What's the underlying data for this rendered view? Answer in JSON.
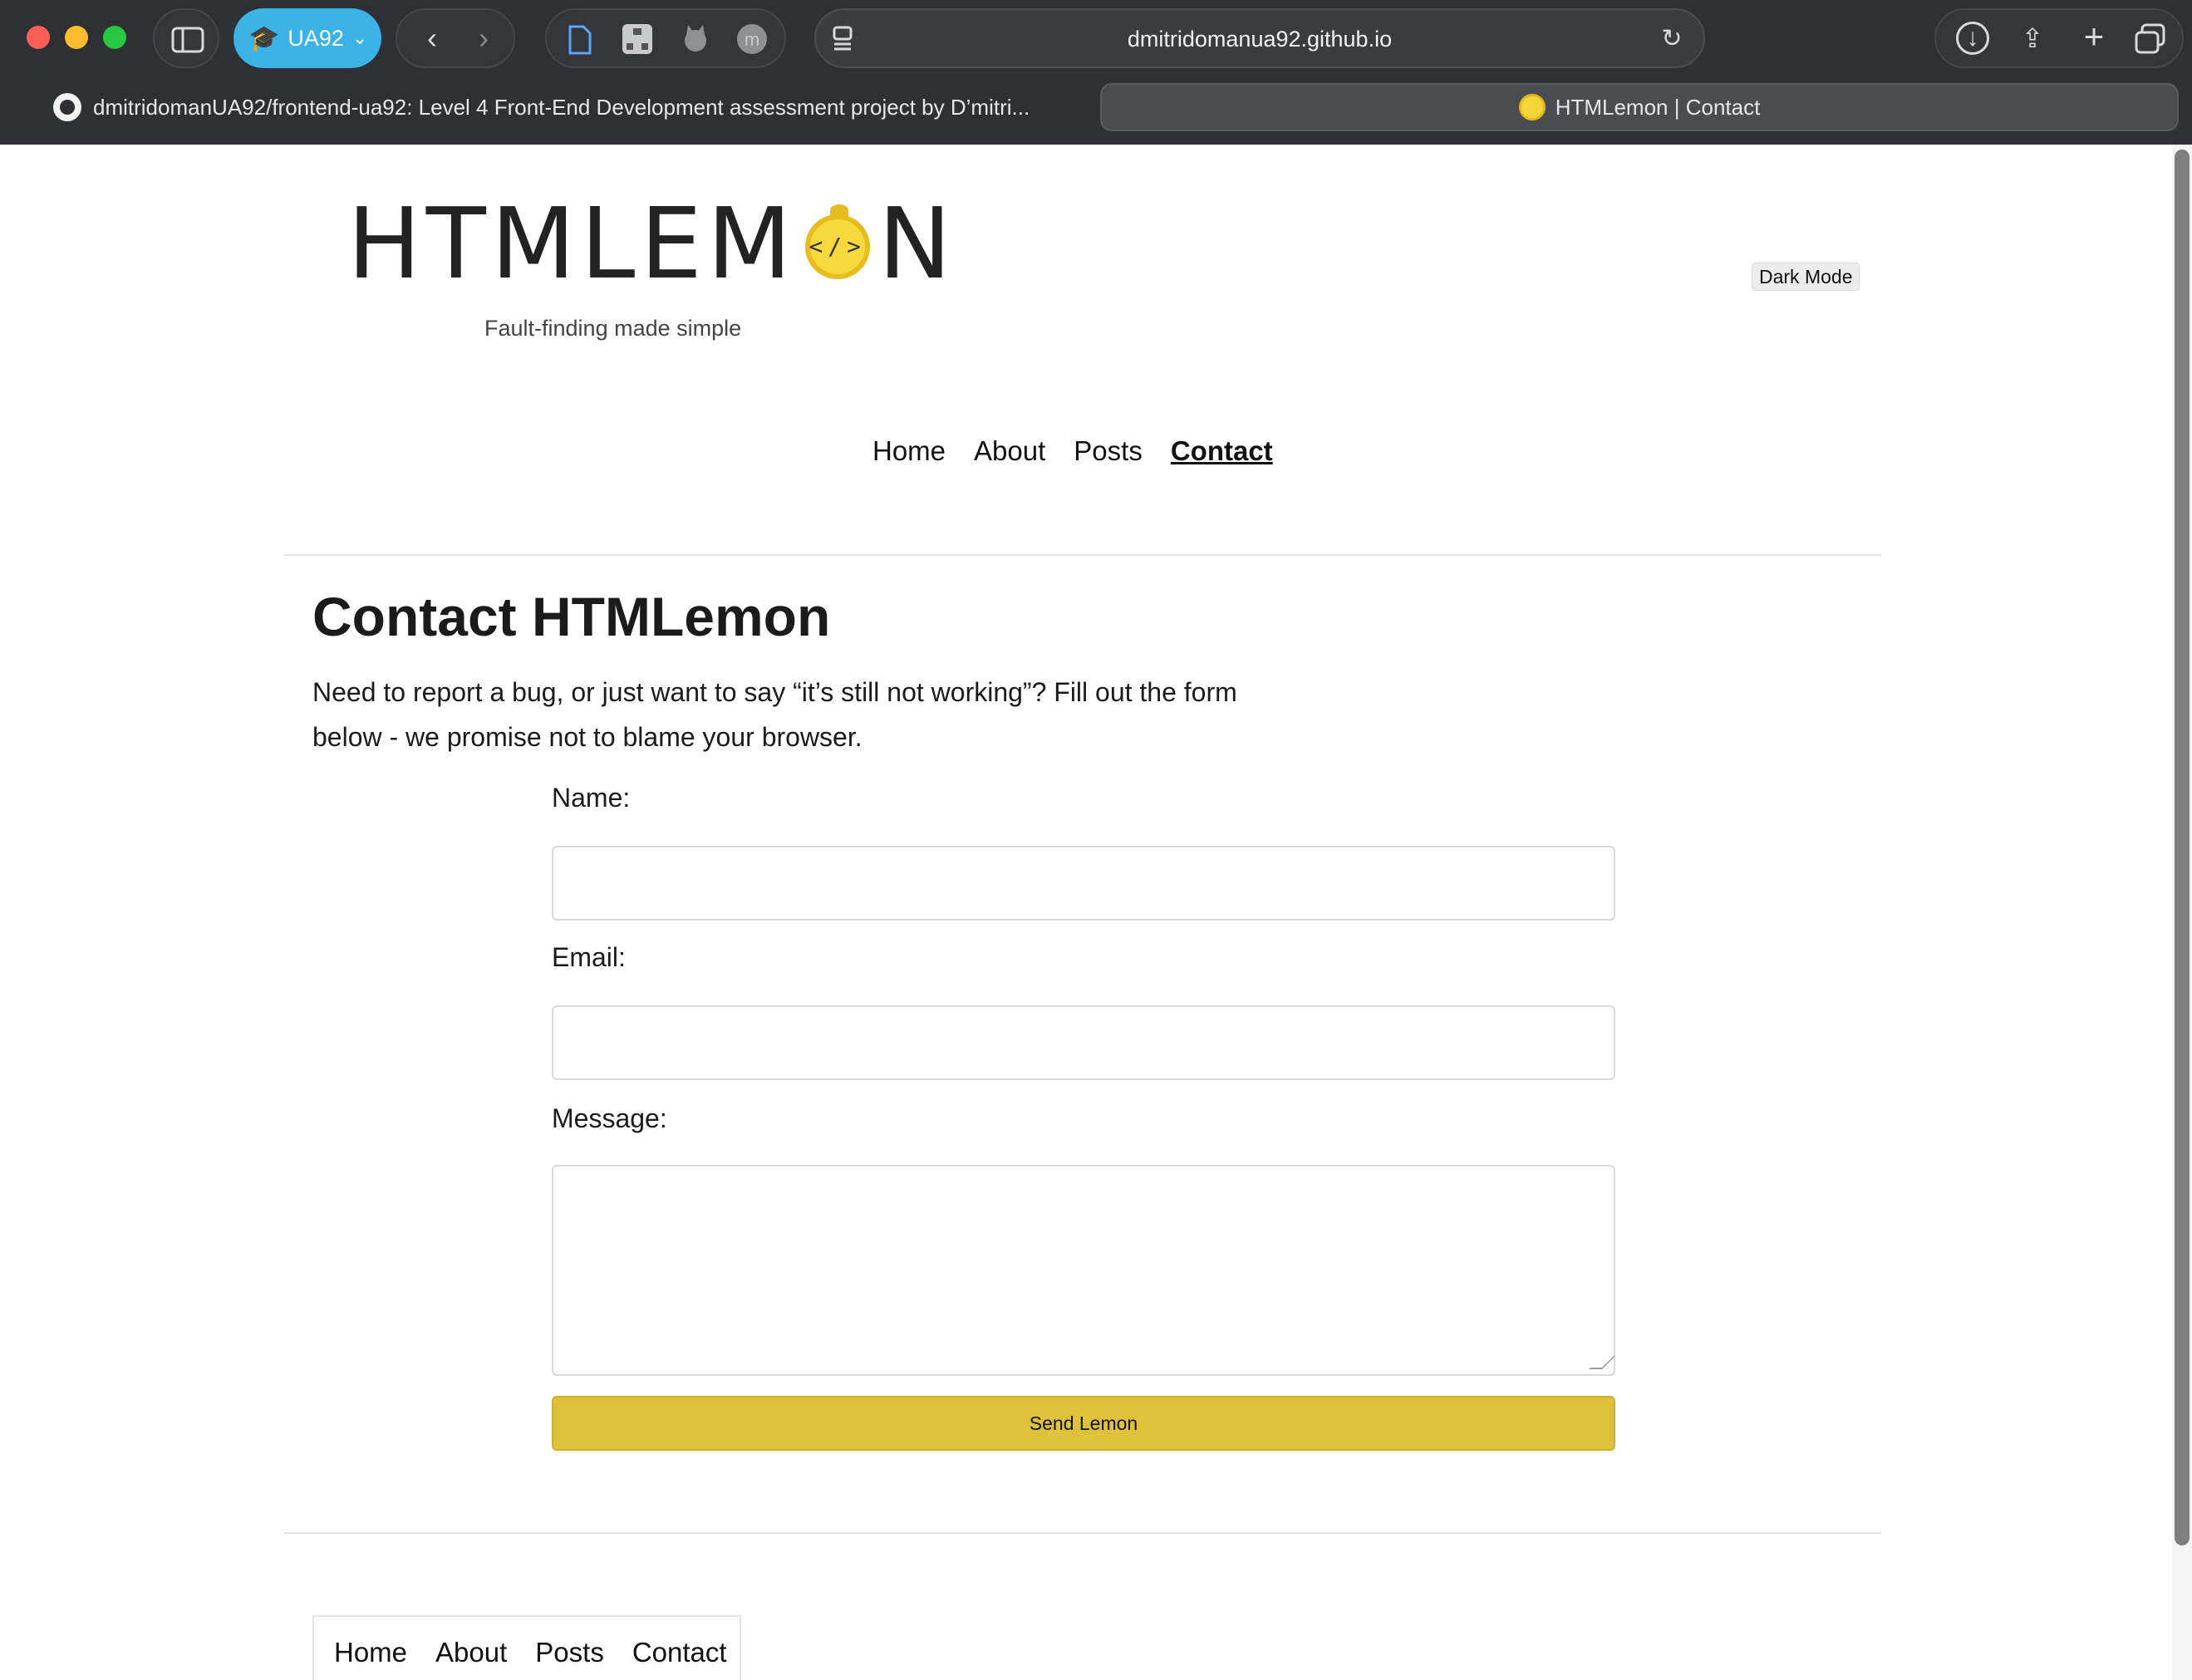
{
  "browser": {
    "profile_label": "UA92",
    "url": "dmitridomanua92.github.io",
    "tabs": [
      {
        "label": "dmitridomanUA92/frontend-ua92: Level 4 Front-End Development assessment project by D’mitri..."
      },
      {
        "label": "HTMLemon | Contact"
      }
    ]
  },
  "header": {
    "logo_text_left": "HTMLEM",
    "logo_text_right": "N",
    "logo_o_glyph": "</>",
    "tagline": "Fault-finding made simple",
    "dark_mode_label": "Dark Mode"
  },
  "nav": {
    "items": [
      "Home",
      "About",
      "Posts",
      "Contact"
    ],
    "active": "Contact"
  },
  "main": {
    "title": "Contact HTMLemon",
    "intro": "Need to report a bug, or just want to say “it’s still not working”? Fill out the form below - we promise not to blame your browser.",
    "form": {
      "name_label": "Name:",
      "email_label": "Email:",
      "message_label": "Message:",
      "name_value": "",
      "email_value": "",
      "message_value": "",
      "submit_label": "Send Lemon"
    }
  },
  "footer": {
    "nav": [
      "Home",
      "About",
      "Posts",
      "Contact"
    ]
  },
  "colors": {
    "accent": "#dfc23c",
    "profile": "#3bb3e6"
  }
}
